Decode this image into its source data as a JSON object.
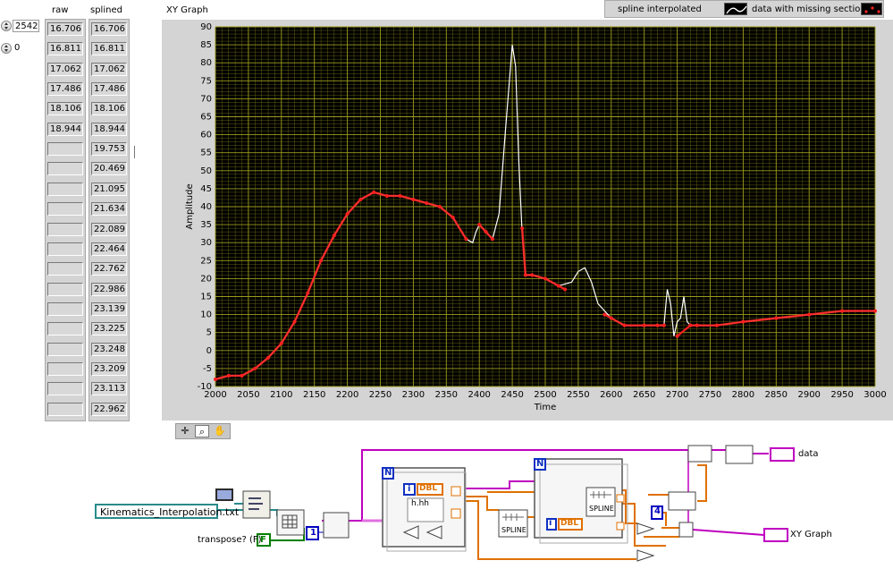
{
  "front_panel": {
    "index_values": [
      "2542",
      "0"
    ],
    "raw_header": "raw",
    "splined_header": "splined",
    "raw_values": [
      "16.706",
      "16.811",
      "17.062",
      "17.486",
      "18.106",
      "18.944",
      "",
      "",
      "",
      "",
      "",
      "",
      "",
      "",
      "",
      "",
      "",
      "",
      ""
    ],
    "splined_values": [
      "16.706",
      "16.811",
      "17.062",
      "17.486",
      "18.106",
      "18.944",
      "19.753",
      "20.469",
      "21.095",
      "21.634",
      "22.089",
      "22.464",
      "22.762",
      "22.986",
      "23.139",
      "23.225",
      "23.248",
      "23.209",
      "23.113",
      "22.962"
    ],
    "graph_title": "XY Graph",
    "legend": {
      "series": [
        {
          "name": "spline interpolated",
          "color": "#ffffff",
          "style": "line"
        },
        {
          "name": "data with missing sections",
          "color": "#ff2020",
          "style": "points"
        }
      ]
    },
    "toolbar": [
      {
        "icon": "crosshair-icon"
      },
      {
        "icon": "zoom-icon",
        "active": true
      },
      {
        "icon": "hand-pan-icon"
      }
    ]
  },
  "block_diagram": {
    "file_path": "Kinematics_Interpolation.txt",
    "transpose_label": "transpose? (F)",
    "transpose_constant": "F",
    "constant_1": "1",
    "constant_4": "4",
    "dbl_label": "DBL",
    "spline_label": "SPLINE",
    "loop_n": "N",
    "loop_i": "i",
    "data_indicator_label": "data",
    "graph_indicator_label": "XY Graph",
    "format_label": "h.hh"
  },
  "chart_data": {
    "type": "line",
    "xlabel": "Time",
    "ylabel": "Amplitude",
    "xlim": [
      2000,
      3000
    ],
    "ylim": [
      -10,
      90
    ],
    "x_ticks": [
      2000,
      2050,
      2100,
      2150,
      2200,
      2250,
      2300,
      2350,
      2400,
      2450,
      2500,
      2550,
      2600,
      2650,
      2700,
      2750,
      2800,
      2850,
      2900,
      2950,
      3000
    ],
    "y_ticks": [
      -10,
      -5,
      0,
      5,
      10,
      15,
      20,
      25,
      30,
      35,
      40,
      45,
      50,
      55,
      60,
      65,
      70,
      75,
      80,
      85,
      90
    ],
    "plot_background": "#000000",
    "grid": true,
    "grid_color": "#9c9c1c",
    "series": [
      {
        "name": "spline interpolated",
        "color": "#ffffff",
        "x": [
          2000,
          2020,
          2040,
          2060,
          2080,
          2100,
          2120,
          2140,
          2160,
          2180,
          2200,
          2220,
          2240,
          2260,
          2280,
          2300,
          2320,
          2340,
          2360,
          2380,
          2390,
          2395,
          2400,
          2410,
          2420,
          2430,
          2440,
          2450,
          2455,
          2460,
          2465,
          2470,
          2480,
          2500,
          2520,
          2540,
          2550,
          2560,
          2570,
          2580,
          2600,
          2620,
          2650,
          2670,
          2680,
          2685,
          2690,
          2695,
          2700,
          2705,
          2710,
          2715,
          2720,
          2730,
          2760,
          2800,
          2850,
          2900,
          2950,
          3000
        ],
        "y": [
          -8,
          -7,
          -7,
          -5,
          -2,
          2,
          8,
          16,
          25,
          32,
          38,
          42,
          44,
          43,
          43,
          42,
          41,
          40,
          37,
          31,
          30,
          33,
          35,
          33,
          31,
          38,
          62,
          85,
          79,
          52,
          32,
          21,
          21,
          20,
          18,
          19,
          22,
          23,
          19,
          13,
          9,
          7,
          7,
          7,
          7,
          17,
          13,
          4,
          8,
          9,
          15,
          8,
          7,
          7,
          7,
          8,
          9,
          10,
          11,
          11
        ]
      },
      {
        "name": "data with missing sections",
        "color": "#ff2020",
        "x": [
          2000,
          2020,
          2040,
          2060,
          2080,
          2100,
          2120,
          2140,
          2160,
          2180,
          2200,
          2220,
          2240,
          2260,
          2280,
          2300,
          2320,
          2340,
          2360,
          2380,
          2400,
          2410,
          2420,
          2465,
          2470,
          2480,
          2500,
          2520,
          2530,
          2590,
          2600,
          2620,
          2650,
          2670,
          2680,
          2700,
          2720,
          2730,
          2760,
          2800,
          2850,
          2900,
          2950,
          3000
        ],
        "y": [
          -8,
          -7,
          -7,
          -5,
          -2,
          2,
          8,
          16,
          25,
          32,
          38,
          42,
          44,
          43,
          43,
          42,
          41,
          40,
          37,
          31,
          35,
          33,
          31,
          34,
          21,
          21,
          20,
          18,
          17,
          10,
          9,
          7,
          7,
          7,
          7,
          4,
          7,
          7,
          7,
          8,
          9,
          10,
          11,
          11
        ]
      }
    ]
  }
}
